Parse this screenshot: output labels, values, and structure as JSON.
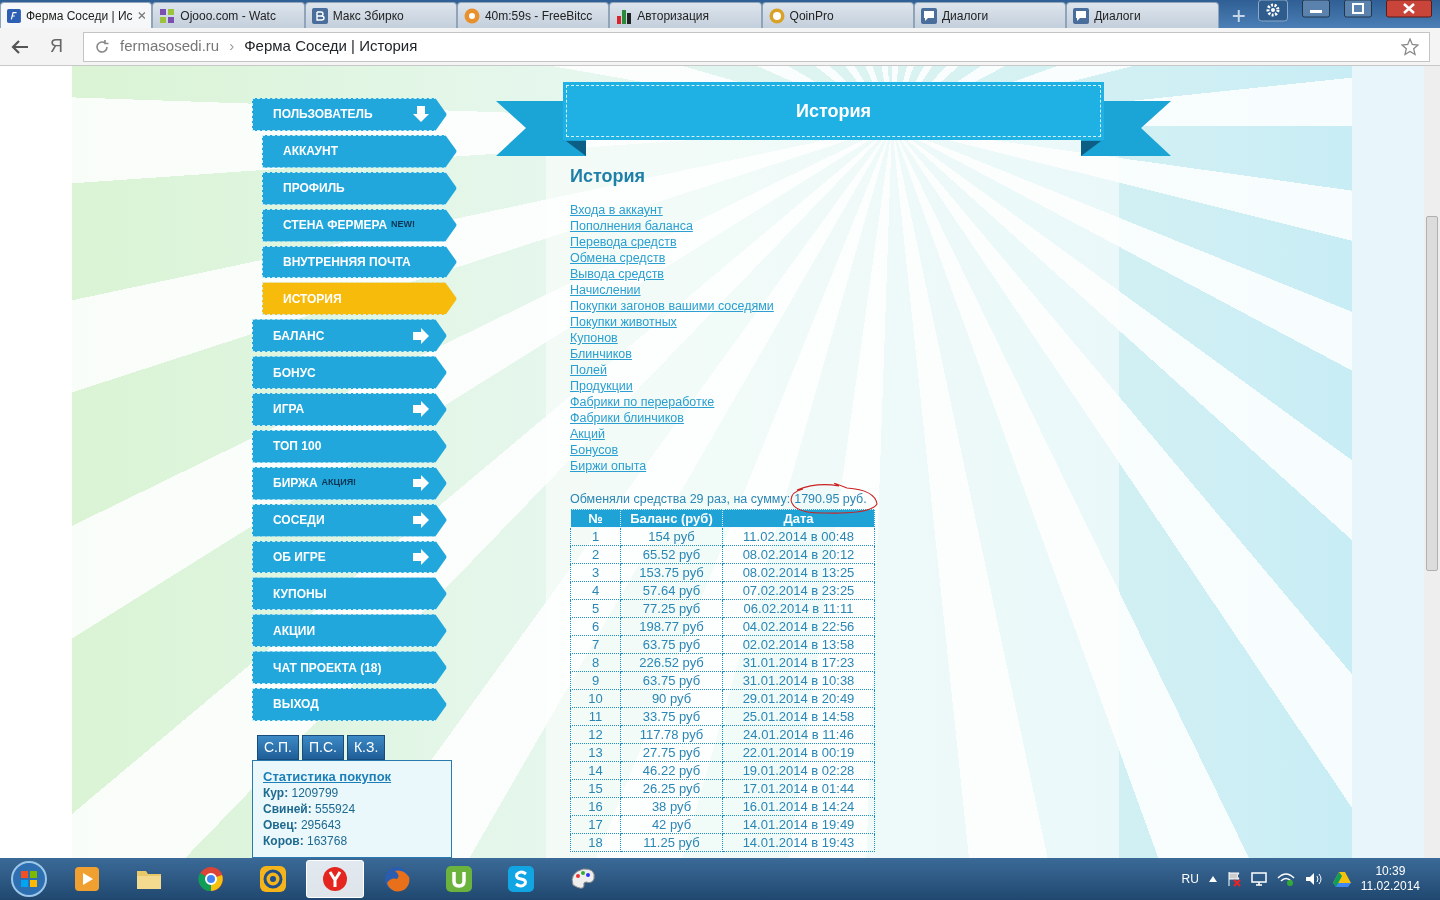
{
  "browser": {
    "tabs": [
      {
        "title": "Ферма Соседи | Ис",
        "kind": "fs",
        "selected": true
      },
      {
        "title": "Ojooo.com - Watc",
        "kind": "grid",
        "selected": false
      },
      {
        "title": "Макс Збирко",
        "kind": "vk",
        "selected": false
      },
      {
        "title": "40m:59s - FreeBitcc",
        "kind": "bitcoin",
        "selected": false
      },
      {
        "title": "Авторизация",
        "kind": "chart",
        "selected": false
      },
      {
        "title": "QoinPro",
        "kind": "qp",
        "selected": false
      },
      {
        "title": "Диалоги",
        "kind": "chat",
        "selected": false
      },
      {
        "title": "Диалоги",
        "kind": "chat",
        "selected": false
      }
    ],
    "address": {
      "domain": "fermasosedi.ru",
      "separator": "›",
      "page_title": "Ферма Соседи | История"
    },
    "back_letter": "Я"
  },
  "sidebar": {
    "items": [
      {
        "label": "ПОЛЬЗОВАТЕЛЬ",
        "selected": false,
        "expanded": true,
        "children": [
          {
            "label": "АККАУНТ",
            "selected": false
          },
          {
            "label": "ПРОФИЛЬ",
            "selected": false
          },
          {
            "label": "СТЕНА ФЕРМЕРА",
            "badge": "NEW!",
            "selected": false
          },
          {
            "label": "ВНУТРЕННЯЯ ПОЧТА",
            "selected": false
          },
          {
            "label": "ИСТОРИЯ",
            "selected": true
          }
        ]
      },
      {
        "label": "БАЛАНС",
        "selected": false,
        "expanded": false
      },
      {
        "label": "БОНУС",
        "selected": false
      },
      {
        "label": "ИГРА",
        "selected": false,
        "expanded": false
      },
      {
        "label": "ТОП 100",
        "selected": false
      },
      {
        "label": "БИРЖА",
        "badge": "АКЦИЯ!",
        "selected": false,
        "expanded": false
      },
      {
        "label": "СОСЕДИ",
        "selected": false,
        "expanded": false
      },
      {
        "label": "ОБ ИГРЕ",
        "selected": false,
        "expanded": false
      },
      {
        "label": "КУПОНЫ",
        "selected": false
      },
      {
        "label": "АКЦИИ",
        "selected": false
      },
      {
        "label": "ЧАТ ПРОЕКТА (18)",
        "selected": false
      },
      {
        "label": "ВЫХОД",
        "selected": false
      }
    ],
    "stats_tabs": [
      "С.П.",
      "П.С.",
      "К.З."
    ],
    "stats": {
      "title": "Статистика покупок",
      "lines": [
        {
          "label": "Кур:",
          "value": "1209799"
        },
        {
          "label": "Свиней:",
          "value": "555924"
        },
        {
          "label": "Овец:",
          "value": "295643"
        },
        {
          "label": "Коров:",
          "value": "163768"
        }
      ]
    }
  },
  "main": {
    "ribbon_title": "История",
    "title": "История",
    "links": [
      "Входа в аккаунт",
      "Пополнения баланса",
      "Перевода средств",
      "Обмена средств",
      "Вывода средств",
      "Начислении",
      "Покупки загонов вашими соседями",
      "Покупки животных",
      "Купонов",
      "Блинчиков",
      "Полей",
      "Продукции",
      "Фабрики по переработке",
      "Фабрики блинчиков",
      "Акций",
      "Бонусов",
      "Биржи опыта"
    ],
    "summary": {
      "text": "Обменяли средства 29 раз, на сумму:",
      "amount": "1790.95 руб."
    },
    "table": {
      "columns": [
        "№",
        "Баланс (руб)",
        "Дата"
      ],
      "rows": [
        [
          "1",
          "154 руб",
          "11.02.2014 в 00:48"
        ],
        [
          "2",
          "65.52 руб",
          "08.02.2014 в 20:12"
        ],
        [
          "3",
          "153.75 руб",
          "08.02.2014 в 13:25"
        ],
        [
          "4",
          "57.64 руб",
          "07.02.2014 в 23:25"
        ],
        [
          "5",
          "77.25 руб",
          "06.02.2014 в 11:11"
        ],
        [
          "6",
          "198.77 руб",
          "04.02.2014 в 22:56"
        ],
        [
          "7",
          "63.75 руб",
          "02.02.2014 в 13:58"
        ],
        [
          "8",
          "226.52 руб",
          "31.01.2014 в 17:23"
        ],
        [
          "9",
          "63.75 руб",
          "31.01.2014 в 10:38"
        ],
        [
          "10",
          "90 руб",
          "29.01.2014 в 20:49"
        ],
        [
          "11",
          "33.75 руб",
          "25.01.2014 в 14:58"
        ],
        [
          "12",
          "117.78 руб",
          "24.01.2014 в 11:46"
        ],
        [
          "13",
          "27.75 руб",
          "22.01.2014 в 00:19"
        ],
        [
          "14",
          "46.22 руб",
          "19.01.2014 в 02:28"
        ],
        [
          "15",
          "26.25 руб",
          "17.01.2014 в 01:44"
        ],
        [
          "16",
          "38 руб",
          "16.01.2014 в 14:24"
        ],
        [
          "17",
          "42 руб",
          "14.01.2014 в 19:49"
        ],
        [
          "18",
          "11.25 руб",
          "14.01.2014 в 19:43"
        ]
      ]
    }
  },
  "taskbar": {
    "apps": [
      {
        "kind": "media",
        "active": false
      },
      {
        "kind": "folder",
        "active": false
      },
      {
        "kind": "chrome",
        "active": false
      },
      {
        "kind": "mail",
        "active": false
      },
      {
        "kind": "yandex",
        "active": true
      },
      {
        "kind": "firefox",
        "active": false
      },
      {
        "kind": "torrent",
        "active": false
      },
      {
        "kind": "skype",
        "active": false
      },
      {
        "kind": "paint",
        "active": false
      }
    ],
    "language": "RU",
    "time": "10:39",
    "date": "11.02.2014"
  }
}
